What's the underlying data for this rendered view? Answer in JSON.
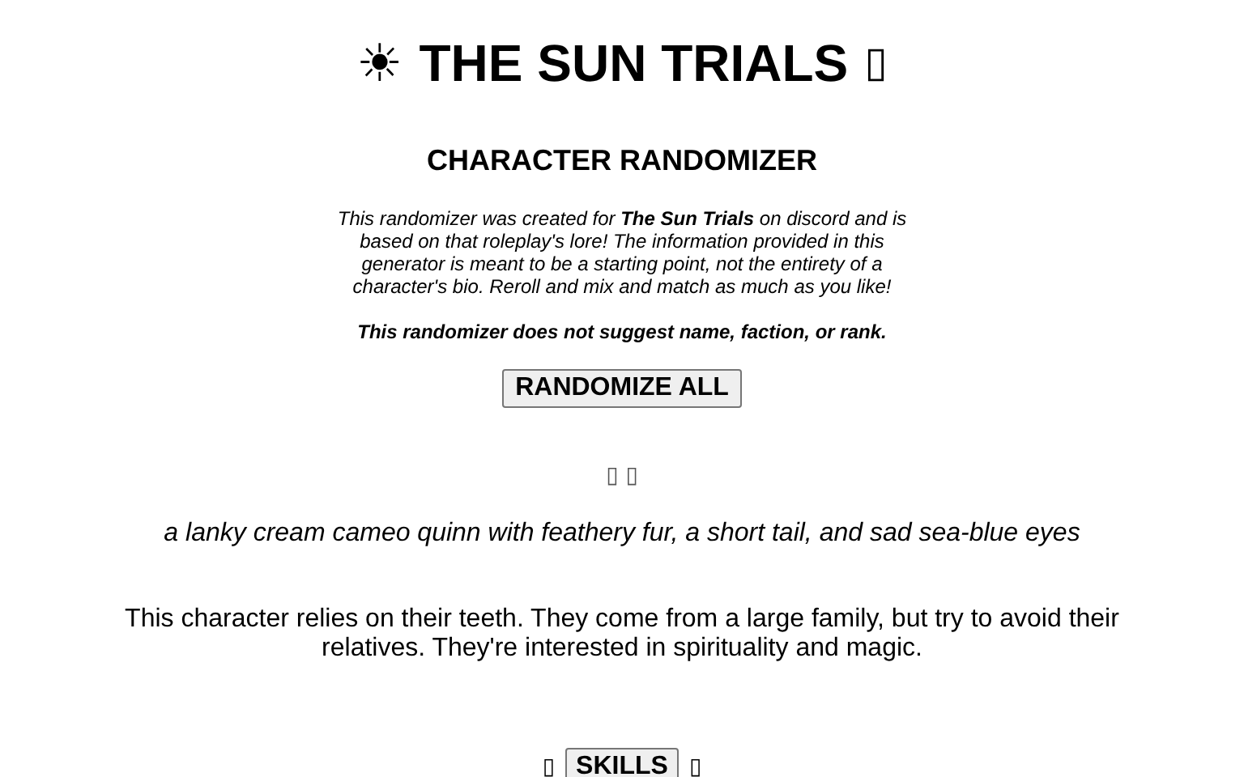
{
  "title": {
    "icon": "☀",
    "text": "THE SUN TRIALS",
    "trail": "▯"
  },
  "subtitle": "CHARACTER RANDOMIZER",
  "intro": "This randomizer was created for **The Sun Trials** on discord and is based on that roleplay's lore! The information provided in this generator is meant to be a starting point, not the entirety of a character's bio. Reroll and mix and match as much as you like!",
  "note": "This randomizer does not suggest name, faction, or rank.",
  "randomize_button": "RANDOMIZE ALL",
  "glyphs": "▯ ▯",
  "appearance": "a lanky cream cameo quinn with feathery fur, a short tail, and sad sea-blue eyes",
  "personality": "This character relies on their teeth. They come from a large family, but try to avoid their relatives. They're interested in spirituality and magic.",
  "skills": {
    "left": "▯",
    "button": "SKILLS",
    "right": "▯"
  }
}
